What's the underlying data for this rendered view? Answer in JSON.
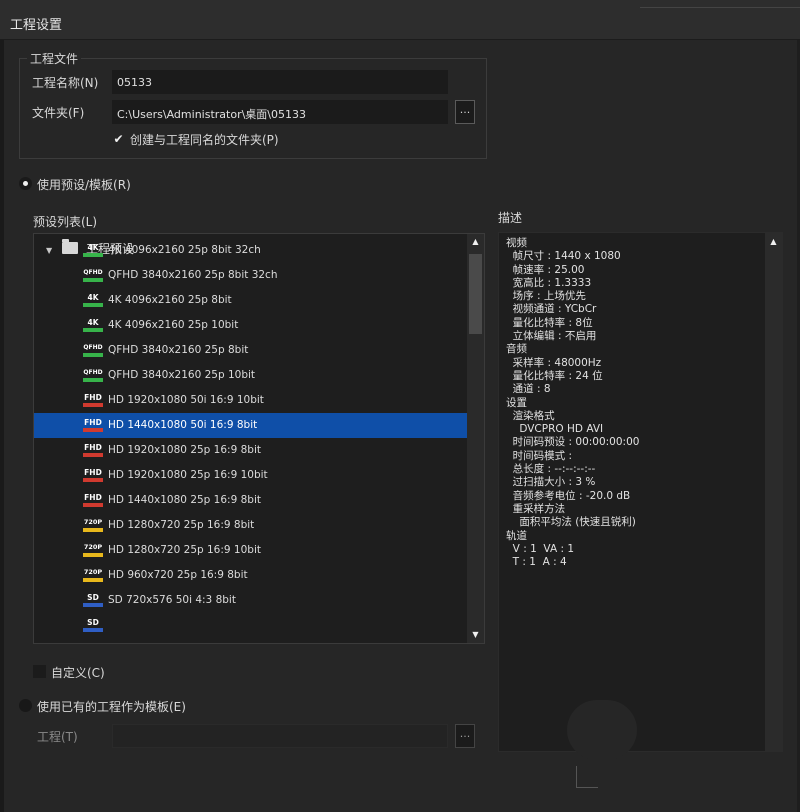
{
  "window": {
    "title": "工程设置"
  },
  "project_file": {
    "group_label": "工程文件",
    "name_label": "工程名称(N)",
    "name_value": "05133",
    "folder_label": "文件夹(F)",
    "folder_value": "C:\\Users\\Administrator\\桌面\\05133",
    "browse_label": "...",
    "create_folder_label": "创建与工程同名的文件夹(P)",
    "create_folder_checked": true
  },
  "use_preset": {
    "label": "使用预设/模板(R)",
    "selected": true
  },
  "preset_list": {
    "label": "预设列表(L)",
    "root": "工程预设",
    "items": [
      {
        "badge": "4K",
        "badge_type": "k4",
        "name": "4K 4096x2160 25p 8bit 32ch"
      },
      {
        "badge": "QFHD",
        "badge_type": "qfhd",
        "name": "QFHD 3840x2160 25p 8bit 32ch"
      },
      {
        "badge": "4K",
        "badge_type": "k4",
        "name": "4K 4096x2160 25p 8bit"
      },
      {
        "badge": "4K",
        "badge_type": "k4",
        "name": "4K 4096x2160 25p 10bit"
      },
      {
        "badge": "QFHD",
        "badge_type": "qfhd",
        "name": "QFHD 3840x2160 25p 8bit"
      },
      {
        "badge": "QFHD",
        "badge_type": "qfhd",
        "name": "QFHD 3840x2160 25p 10bit"
      },
      {
        "badge": "FHD",
        "badge_type": "fhd",
        "name": "HD 1920x1080 50i 16:9 10bit"
      },
      {
        "badge": "FHD",
        "badge_type": "fhd",
        "name": "HD 1440x1080 50i 16:9 8bit",
        "selected": true
      },
      {
        "badge": "FHD",
        "badge_type": "fhd",
        "name": "HD 1920x1080 25p 16:9 8bit"
      },
      {
        "badge": "FHD",
        "badge_type": "fhd",
        "name": "HD 1920x1080 25p 16:9 10bit"
      },
      {
        "badge": "FHD",
        "badge_type": "fhd",
        "name": "HD 1440x1080 25p 16:9 8bit"
      },
      {
        "badge": "720P",
        "badge_type": "p720",
        "name": "HD 1280x720 25p 16:9 8bit"
      },
      {
        "badge": "720P",
        "badge_type": "p720",
        "name": "HD 1280x720 25p 16:9 10bit"
      },
      {
        "badge": "720P",
        "badge_type": "p720",
        "name": "HD 960x720 25p 16:9 8bit"
      },
      {
        "badge": "SD",
        "badge_type": "sd",
        "name": "SD 720x576 50i 4:3 8bit"
      },
      {
        "badge": "SD",
        "badge_type": "sd",
        "name": ""
      }
    ]
  },
  "custom": {
    "label": "自定义(C)",
    "checked": false
  },
  "use_existing": {
    "label": "使用已有的工程作为模板(E)",
    "selected": false
  },
  "project_field": {
    "label": "工程(T)",
    "value": "",
    "browse_label": "..."
  },
  "description": {
    "title": "描述",
    "lines": [
      "视频",
      "  帧尺寸 : 1440 x 1080",
      "  帧速率 : 25.00",
      "  宽高比 : 1.3333",
      "  场序 : 上场优先",
      "  视频通道 : YCbCr",
      "  量化比特率 : 8位",
      "  立体编辑 : 不启用",
      "音频",
      "  采样率 : 48000Hz",
      "  量化比特率 : 24 位",
      "  通道 : 8",
      "设置",
      "  渲染格式",
      "    DVCPRO HD AVI",
      "  时间码预设 : 00:00:00:00",
      "  时间码模式 :",
      "  总长度 : --:--:--:--",
      "  过扫描大小 : 3 %",
      "  音频参考电位 : -20.0 dB",
      "  重采样方法",
      "    面积平均法 (快速且锐利)",
      "轨道",
      "  V : 1  VA : 1",
      "  T : 1  A : 4"
    ]
  },
  "icons": {
    "expand": "▼",
    "scroll_up": "▲",
    "scroll_down": "▼",
    "check": "✔"
  }
}
